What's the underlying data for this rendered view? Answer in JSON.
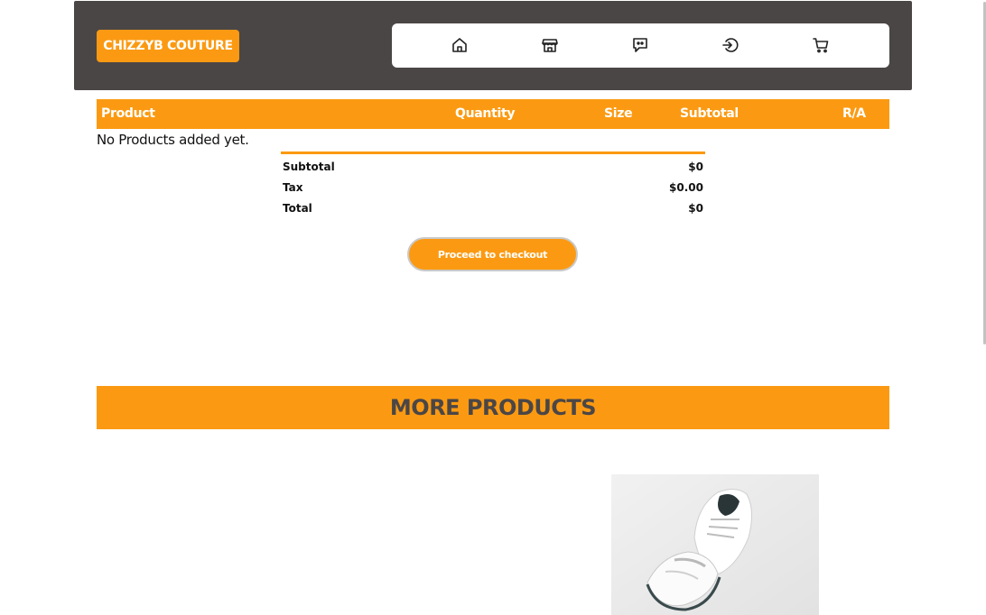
{
  "brand": {
    "label": "CHIZZYB COUTURE"
  },
  "nav": {
    "icons": [
      "home-icon",
      "store-icon",
      "chat-icon",
      "login-icon",
      "cart-icon"
    ]
  },
  "cart_table": {
    "headers": {
      "product": "Product",
      "quantity": "Quantity",
      "size": "Size",
      "subtotal": "Subtotal",
      "remove": "R/A"
    },
    "empty_message": "No Products added yet."
  },
  "totals": {
    "subtotal_label": "Subtotal",
    "subtotal_value": "$0",
    "tax_label": "Tax",
    "tax_value": "$0.00",
    "total_label": "Total",
    "total_value": "$0"
  },
  "checkout": {
    "label": "Proceed to checkout"
  },
  "more_products": {
    "title": "MORE PRODUCTS"
  },
  "colors": {
    "accent": "#fb9a12",
    "header_bg": "#4b4646",
    "white": "#ffffff"
  }
}
